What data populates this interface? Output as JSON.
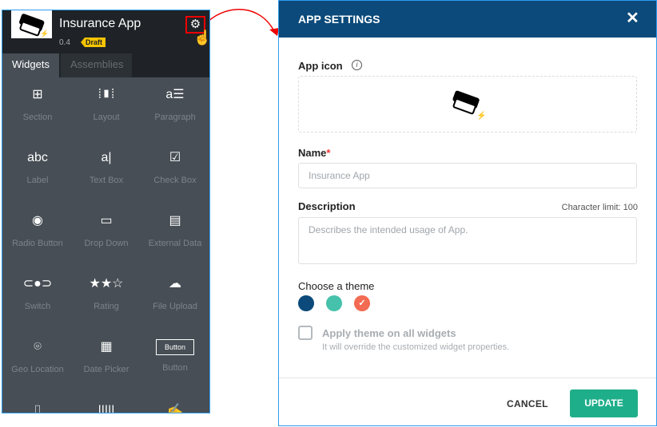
{
  "app": {
    "title": "Insurance App",
    "version": "0.4",
    "status": "Draft"
  },
  "tabs": [
    "Widgets",
    "Assemblies"
  ],
  "widgets": [
    {
      "label": "Section",
      "icon": "section-icon",
      "glyph": "⊞"
    },
    {
      "label": "Layout",
      "icon": "layout-icon",
      "glyph": "⦙▮⦙"
    },
    {
      "label": "Paragraph",
      "icon": "paragraph-icon",
      "glyph": "a☰"
    },
    {
      "label": "Label",
      "icon": "label-icon",
      "glyph": "abc"
    },
    {
      "label": "Text Box",
      "icon": "textbox-icon",
      "glyph": "a|"
    },
    {
      "label": "Check Box",
      "icon": "checkbox-icon",
      "glyph": "☑"
    },
    {
      "label": "Radio Button",
      "icon": "radio-icon",
      "glyph": "◉"
    },
    {
      "label": "Drop Down",
      "icon": "dropdown-icon",
      "glyph": "▭"
    },
    {
      "label": "External Data",
      "icon": "external-data-icon",
      "glyph": "▤"
    },
    {
      "label": "Switch",
      "icon": "switch-icon",
      "glyph": "⊂●⊃"
    },
    {
      "label": "Rating",
      "icon": "rating-icon",
      "glyph": "★★☆"
    },
    {
      "label": "File Upload",
      "icon": "cloud-upload-icon",
      "glyph": "☁"
    },
    {
      "label": "Geo Location",
      "icon": "map-pin-icon",
      "glyph": "⌾"
    },
    {
      "label": "Date Picker",
      "icon": "calendar-icon",
      "glyph": "▦"
    },
    {
      "label": "Button",
      "icon": "button-icon",
      "glyph": "Button"
    }
  ],
  "dialog": {
    "title": "APP SETTINGS",
    "app_icon_label": "App icon",
    "name_label": "Name",
    "name_placeholder": "Insurance App",
    "description_label": "Description",
    "char_limit": "Character limit: 100",
    "description_placeholder": "Describes the intended usage of App.",
    "theme_label": "Choose a theme",
    "themes": [
      "#0b4a7a",
      "#46c1ab",
      "#f26b52"
    ],
    "apply_label": "Apply theme on all widgets",
    "apply_hint": "It will override the customized widget properties.",
    "cancel": "CANCEL",
    "update": "UPDATE"
  }
}
